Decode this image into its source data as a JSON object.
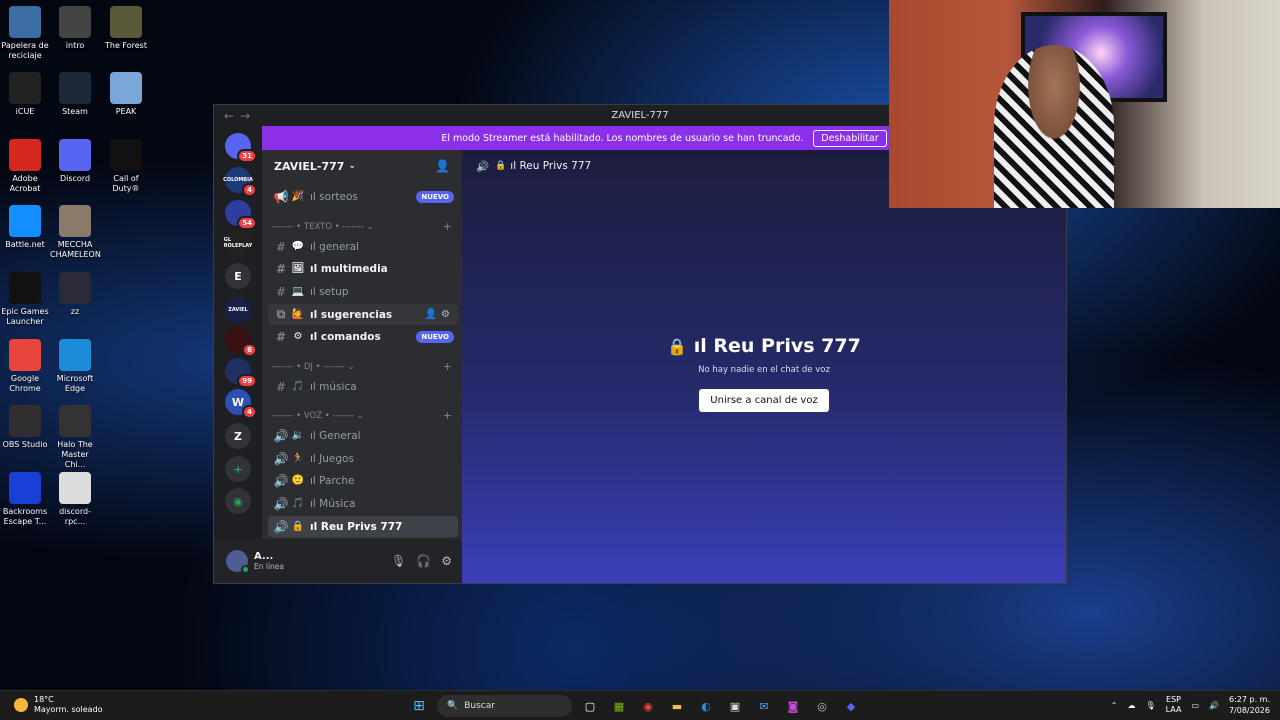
{
  "desktop": {
    "icons": [
      {
        "label": "Papelera de reciclaje",
        "icon": "recycle-bin-icon",
        "color": "#3c6ea5"
      },
      {
        "label": "intro",
        "icon": "video-file-icon",
        "color": "#444444"
      },
      {
        "label": "The Forest",
        "icon": "game-icon",
        "color": "#5a5a3a"
      },
      {
        "label": "iCUE",
        "icon": "icue-icon",
        "color": "#222222"
      },
      {
        "label": "Steam",
        "icon": "steam-icon",
        "color": "#1b2838"
      },
      {
        "label": "PEAK",
        "icon": "peak-icon",
        "color": "#7aa6d9"
      },
      {
        "label": "Adobe Acrobat",
        "icon": "acrobat-icon",
        "color": "#d7261e"
      },
      {
        "label": "Discord",
        "icon": "discord-icon",
        "color": "#5865f2"
      },
      {
        "label": "Call of Duty®",
        "icon": "cod-icon",
        "color": "#111111"
      },
      {
        "label": "Battle.net",
        "icon": "battlenet-icon",
        "color": "#148eff"
      },
      {
        "label": "MECCHA CHAMELEON",
        "icon": "game-icon",
        "color": "#8a7a6a"
      },
      {
        "label": "Epic Games Launcher",
        "icon": "epic-icon",
        "color": "#111111"
      },
      {
        "label": "zz",
        "icon": "zz-icon",
        "color": "#2a2a3a"
      },
      {
        "label": "Google Chrome",
        "icon": "chrome-icon",
        "color": "#e8453c"
      },
      {
        "label": "Microsoft Edge",
        "icon": "edge-icon",
        "color": "#1d8cd8"
      },
      {
        "label": "OBS Studio",
        "icon": "obs-icon",
        "color": "#302e31"
      },
      {
        "label": "Halo The Master Chi...",
        "icon": "halo-icon",
        "color": "#333333"
      },
      {
        "label": "Backrooms Escape T...",
        "icon": "bet-icon",
        "color": "#1a3fd6"
      },
      {
        "label": "discord-rpc...",
        "icon": "settings-file-icon",
        "color": "#dddddd"
      }
    ]
  },
  "discord": {
    "window_title": "ZAVIEL-777",
    "nav_back": "←",
    "nav_forward": "→",
    "banner_text": "El modo Streamer está habilitado. Los nombres de usuario se han truncado.",
    "banner_button": "Deshabilitar",
    "guilds": [
      {
        "label": "",
        "badge": "31"
      },
      {
        "label": "COLOMBIA",
        "badge": "4"
      },
      {
        "label": "",
        "badge": "54"
      },
      {
        "label": "GL ROLEPLAY",
        "badge": ""
      },
      {
        "label": "E",
        "badge": ""
      },
      {
        "label": "ZAVIEL",
        "badge": ""
      },
      {
        "label": "",
        "badge": "6"
      },
      {
        "label": "",
        "badge": "99"
      },
      {
        "label": "W",
        "badge": "4"
      },
      {
        "label": "Z",
        "badge": ""
      }
    ],
    "server_name": "ZAVIEL-777",
    "channels": {
      "sorteos": "ıl sorteos",
      "sorteos_tag": "NUEVO",
      "cat_texto": "------- • TEXTO • -------",
      "general": "ıl general",
      "multimedia": "ıl multimedia",
      "setup": "ıl setup",
      "sugerencias": "ıl sugerencias",
      "comandos": "ıl comandos",
      "comandos_tag": "NUEVO",
      "cat_dj": "------- • DJ • -------",
      "musica": "ıl música",
      "cat_voz": "------- • VOZ • -------",
      "v_general": "ıl General",
      "v_juegos": "ıl Juegos",
      "v_parche": "ıl Parche",
      "v_musica": "ıl Música",
      "v_reu": "ıl Reu Privs 777"
    },
    "user": {
      "name": "A...",
      "status": "En línea"
    },
    "main_header": "ıl Reu Privs 777",
    "center_title": "ıl Reu Privs 777",
    "center_sub": "No hay nadie en el chat de voz",
    "join_button": "Unirse a canal de voz"
  },
  "taskbar": {
    "temp": "18°C",
    "weather": "Mayorm. soleado",
    "search_placeholder": "Buscar",
    "lang_top": "ESP",
    "lang_bottom": "LAA",
    "time": "6:27 p. m.",
    "date": "7/08/2026"
  }
}
